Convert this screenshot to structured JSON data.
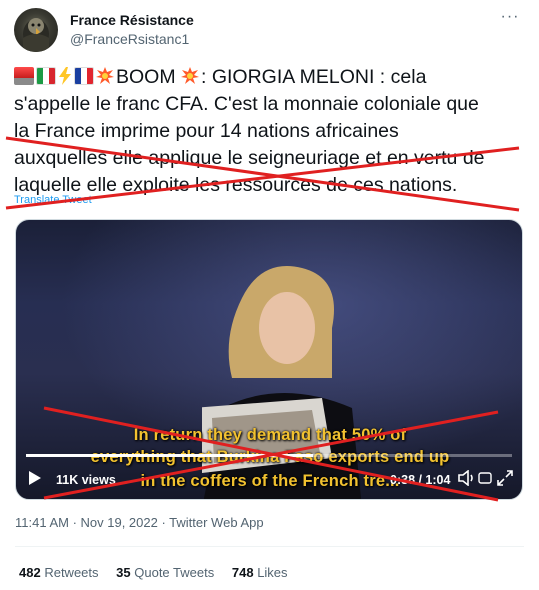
{
  "author": {
    "display_name": "France Résistance",
    "handle": "@FranceRsistanc1",
    "avatar_icon": "eagle-avatar-icon"
  },
  "more_icon": "more-dots-icon",
  "tweet": {
    "emoji_icons": [
      "police-light-emoji",
      "italy-flag-emoji",
      "lightning-emoji",
      "france-flag-emoji",
      "collision-emoji"
    ],
    "text_line1": "BOOM ",
    "text_line1b": ": GIORGIA MELONI : cela",
    "text_line2": "s'appelle le franc CFA. C'est la monnaie coloniale que",
    "text_line3": "la France imprime pour 14 nations africaines",
    "text_line4": "auxquelles elle applique le seigneuriage et en vertu de",
    "text_line5": "laquelle elle exploite les ressources de ces nations.",
    "translate_label": "Translate Tweet"
  },
  "video": {
    "subtitle_1": "In return they demand that 50% of",
    "subtitle_2": "everything that Burkina Faso exports end up",
    "subtitle_3": "in the coffers of the French tre...",
    "views": "11K views",
    "time": "0:38 / 1:04",
    "progress": 0.59,
    "play_icon": "play-icon",
    "volume_icon": "volume-icon",
    "gif_icon": "gif-icon",
    "fullscreen_icon": "fullscreen-icon"
  },
  "meta": {
    "timestamp": "11:41 AM · Nov 19, 2022 · Twitter Web App"
  },
  "stats": {
    "retweets_count": "482",
    "retweets_label": "Retweets",
    "quotes_count": "35",
    "quotes_label": "Quote Tweets",
    "likes_count": "748",
    "likes_label": "Likes"
  },
  "colors": {
    "cross_red": "#e02020",
    "link_blue": "#1d9bf0",
    "subtitle_yellow": "#f2c230"
  }
}
